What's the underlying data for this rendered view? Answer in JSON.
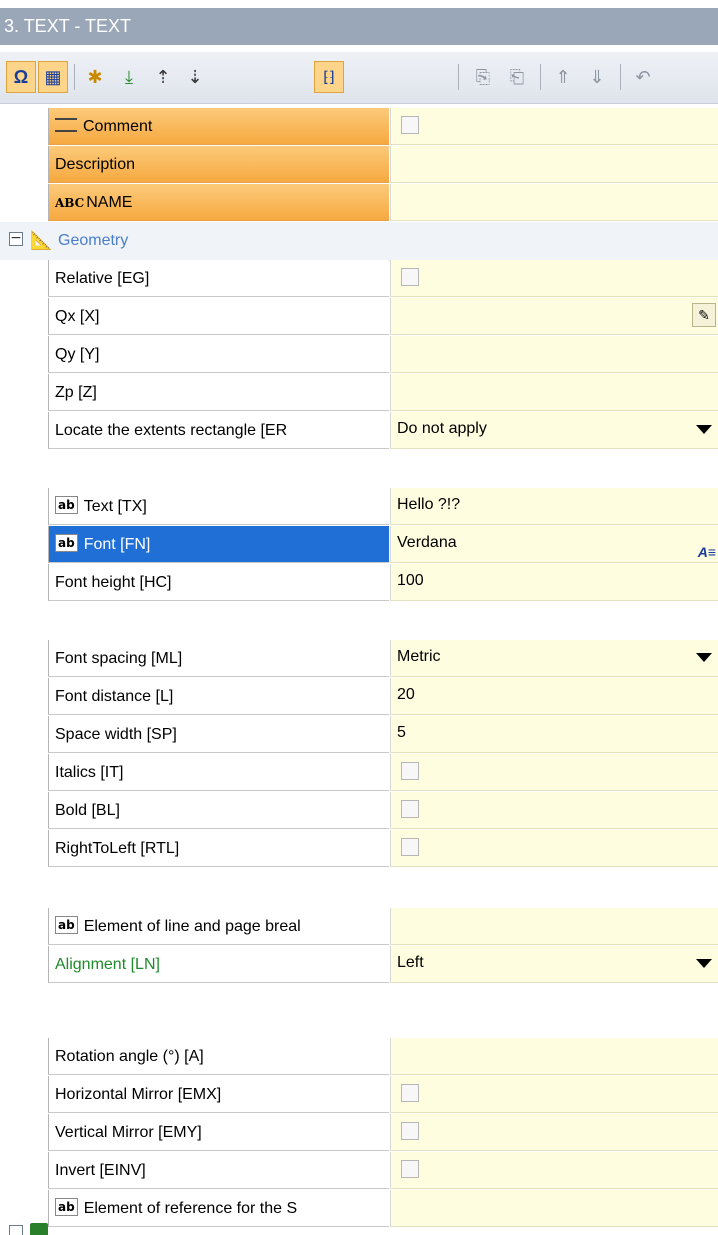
{
  "window": {
    "title": "3. TEXT - TEXT"
  },
  "toolbar": {
    "buttons": [
      {
        "icon": "omega-icon",
        "glyph": "Ω",
        "selected": true
      },
      {
        "icon": "grid-icon",
        "glyph": "▦",
        "selected": true
      },
      {
        "icon": "new-icon",
        "glyph": "✱",
        "selected": false
      },
      {
        "icon": "import-icon",
        "glyph": "⤓",
        "selected": false
      },
      {
        "icon": "sort-up-icon",
        "glyph": "⇡",
        "selected": false
      },
      {
        "icon": "sort-down-icon",
        "glyph": "⇣",
        "selected": false
      },
      {
        "icon": "bracket-select-icon",
        "glyph": "⁅⁆",
        "selected": true
      },
      {
        "icon": "fields-icon",
        "glyph": "⎘",
        "selected": false
      },
      {
        "icon": "fields-edit-icon",
        "glyph": "⎗",
        "selected": false
      },
      {
        "icon": "move-up-icon",
        "glyph": "⇑",
        "selected": false
      },
      {
        "icon": "move-down-icon",
        "glyph": "⇓",
        "selected": false
      },
      {
        "icon": "undo-icon",
        "glyph": "↶",
        "selected": false
      }
    ]
  },
  "properties": {
    "comment": {
      "label": "Comment"
    },
    "description": {
      "label": "Description",
      "value": ""
    },
    "name": {
      "label": "NAME",
      "prefix": "ABC",
      "value": ""
    },
    "geometry": {
      "label": "Geometry"
    },
    "relative": {
      "label": "Relative [EG]"
    },
    "qx": {
      "label": "Qx [X]",
      "value": ""
    },
    "qy": {
      "label": "Qy [Y]",
      "value": ""
    },
    "zp": {
      "label": "Zp [Z]",
      "value": ""
    },
    "extents": {
      "label": "Locate the extents rectangle [ER",
      "value": "Do not apply"
    },
    "text": {
      "label": "Text [TX]",
      "value": "Hello ?!?"
    },
    "font": {
      "label": "Font [FN]",
      "value": "Verdana"
    },
    "font_height": {
      "label": "Font height [HC]",
      "value": "100"
    },
    "font_spacing": {
      "label": "Font spacing [ML]",
      "value": "Metric"
    },
    "font_distance": {
      "label": "Font distance [L]",
      "value": "20"
    },
    "space_width": {
      "label": "Space width [SP]",
      "value": "5"
    },
    "italics": {
      "label": "Italics [IT]"
    },
    "bold": {
      "label": "Bold [BL]"
    },
    "rtl": {
      "label": "RightToLeft [RTL]"
    },
    "line_break": {
      "label": "Element of line and page breal",
      "value": ""
    },
    "alignment": {
      "label": "Alignment [LN]",
      "value": "Left"
    },
    "rotation": {
      "label": "Rotation angle (°) [A]",
      "value": ""
    },
    "hmirror": {
      "label": "Horizontal Mirror [EMX]"
    },
    "vmirror": {
      "label": "Vertical Mirror [EMY]"
    },
    "invert": {
      "label": "Invert [EINV]"
    },
    "reference": {
      "label": "Element of reference for the S",
      "value": ""
    }
  },
  "badge": {
    "ab": "ab"
  }
}
